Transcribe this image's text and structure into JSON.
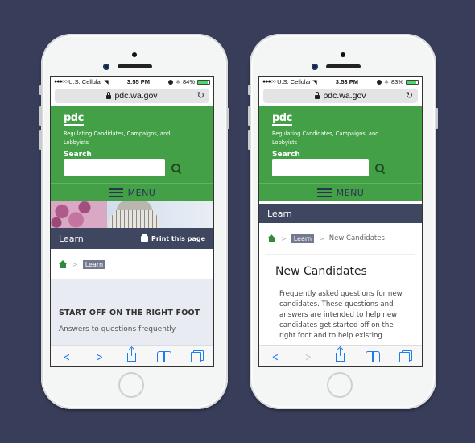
{
  "phones": [
    {
      "status": {
        "carrier": "U.S. Cellular",
        "time": "3:55 PM",
        "battery_text": "84%",
        "battery_level": 0.84
      },
      "url": "pdc.wa.gov",
      "header": {
        "logo": "pdc",
        "tagline": "Regulating Candidates, Campaigns, and Lobbyists",
        "search_label": "Search",
        "search_value": "",
        "menu_label": "MENU"
      },
      "section_title": "Learn",
      "print_label": "Print this page",
      "breadcrumb": {
        "tag": "Learn"
      },
      "content": {
        "heading": "START OFF ON THE RIGHT FOOT",
        "partial_text": "Answers to questions frequently"
      }
    },
    {
      "status": {
        "carrier": "U.S. Cellular",
        "time": "3:53 PM",
        "battery_text": "83%",
        "battery_level": 0.83
      },
      "url": "pdc.wa.gov",
      "header": {
        "logo": "pdc",
        "tagline": "Regulating Candidates, Campaigns, and Lobbyists",
        "search_label": "Search",
        "search_value": "",
        "menu_label": "MENU"
      },
      "section_title": "Learn",
      "breadcrumb": {
        "tag": "Learn",
        "current": "New Candidates"
      },
      "content": {
        "title": "New Candidates",
        "text": "Frequently asked questions for new candidates. These questions and answers are intended to help new candidates get started off on the right foot and to help existing"
      }
    }
  ],
  "colors": {
    "background": "#383d59",
    "brand_green": "#43a047",
    "section_bar": "#3f4660",
    "ios_blue": "#1a7dea"
  }
}
